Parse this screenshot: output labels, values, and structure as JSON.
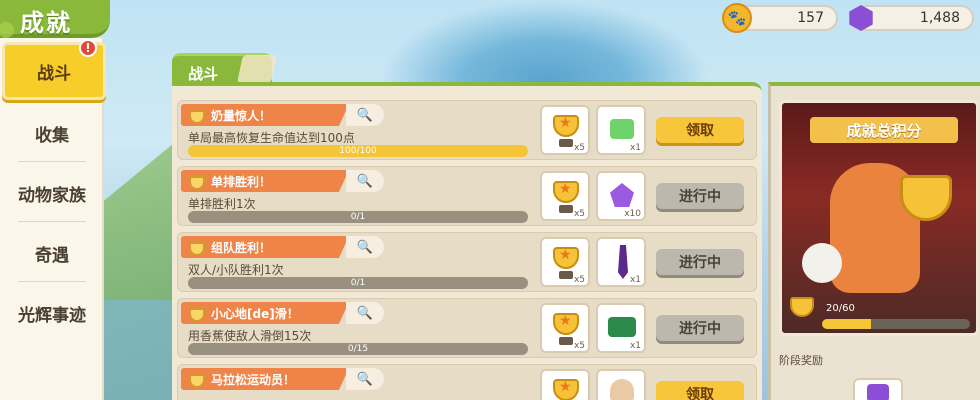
{
  "header": {
    "title": "成就"
  },
  "currency": {
    "paw": "157",
    "gem": "1,488"
  },
  "sidebar": {
    "items": [
      {
        "label": "战斗",
        "active": true,
        "alert": "!"
      },
      {
        "label": "收集"
      },
      {
        "label": "动物家族"
      },
      {
        "label": "奇遇"
      },
      {
        "label": "光辉事迹"
      }
    ]
  },
  "main": {
    "tab": "战斗",
    "rows": [
      {
        "title": "奶量惊人！",
        "desc": "单局最高恢复生命值达到100点",
        "progress_text": "100/100",
        "progress": 1.0,
        "reward1_qty": "x5",
        "reward2_qty": "x1",
        "button": "领取",
        "button_state": "claim"
      },
      {
        "title": "单排胜利！",
        "desc": "单排胜利1次",
        "progress_text": "0/1",
        "progress": 0.0,
        "reward1_qty": "x5",
        "reward2_qty": "x10",
        "button": "进行中",
        "button_state": "in_progress"
      },
      {
        "title": "组队胜利！",
        "desc": "双人/小队胜利1次",
        "progress_text": "0/1",
        "progress": 0.0,
        "reward1_qty": "x5",
        "reward2_qty": "x1",
        "button": "进行中",
        "button_state": "in_progress"
      },
      {
        "title": "小心地[de]滑！",
        "desc": "用香蕉使敌人滑倒15次",
        "progress_text": "0/15",
        "progress": 0.0,
        "reward1_qty": "x5",
        "reward2_qty": "x1",
        "button": "进行中",
        "button_state": "in_progress"
      },
      {
        "title": "马拉松运动员！",
        "desc": "",
        "progress_text": "",
        "progress": 0.0,
        "reward1_qty": "",
        "reward2_qty": "",
        "button": "领取",
        "button_state": "claim"
      }
    ]
  },
  "right_panel": {
    "title": "成就总积分",
    "score_text": "20/60",
    "score_progress": 0.333,
    "stage_label": "阶段奖励"
  },
  "colors": {
    "accent_green": "#8ab83a",
    "claim_yellow": "#f7c63a",
    "title_orange": "#ef8448"
  }
}
